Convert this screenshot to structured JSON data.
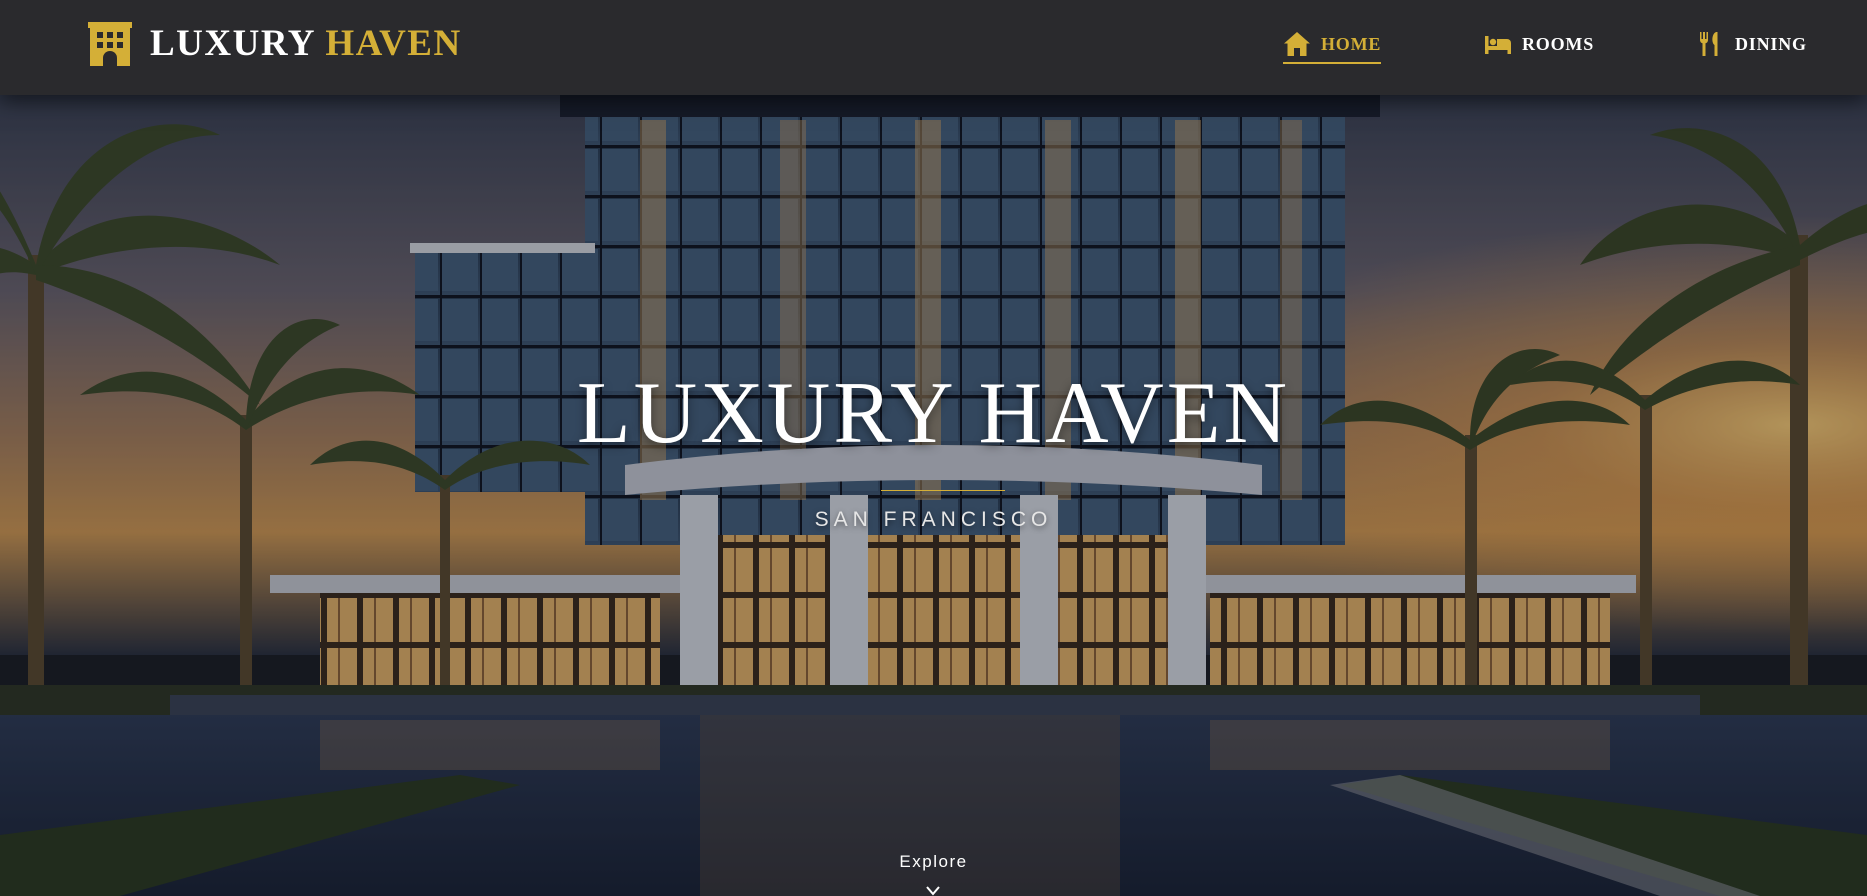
{
  "brand": {
    "name_primary": "LUXURY",
    "name_accent": "HAVEN",
    "icon": "hotel-building-icon"
  },
  "nav": {
    "items": [
      {
        "label": "HOME",
        "icon": "home-icon",
        "active": true
      },
      {
        "label": "ROOMS",
        "icon": "bed-icon",
        "active": false
      },
      {
        "label": "DINING",
        "icon": "utensils-icon",
        "active": false
      }
    ]
  },
  "hero": {
    "title": "LUXURY HAVEN",
    "subtitle": "SAN FRANCISCO",
    "explore_label": "Explore",
    "explore_icon": "chevron-down-icon"
  },
  "colors": {
    "accent_gold": "#d4af37",
    "navbar_bg": "#2a2a2d",
    "text_white": "#ffffff"
  }
}
